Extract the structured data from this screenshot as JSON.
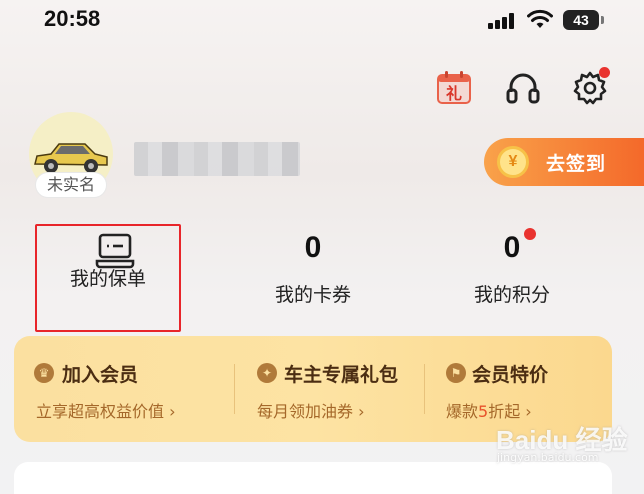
{
  "status_bar": {
    "time": "20:58",
    "battery": "43"
  },
  "header_icons": [
    "gift-calendar-icon",
    "headset-icon",
    "gear-icon"
  ],
  "profile": {
    "verify_status": "未实名",
    "checkin_label": "去签到",
    "coin_symbol": "¥"
  },
  "stats": {
    "policy_label": "我的保单",
    "coupons_value": "0",
    "coupons_label": "我的卡券",
    "points_value": "0",
    "points_label": "我的积分"
  },
  "membership": {
    "items": [
      {
        "title": "加入会员",
        "subtitle": "立享超高权益价值 ›",
        "icon": "crown-icon"
      },
      {
        "title": "车主专属礼包",
        "subtitle": "每月领加油券 ›",
        "icon": "gift-bag-icon"
      },
      {
        "title": "会员特价",
        "subtitle_prefix": "爆款",
        "subtitle_highlight": "5",
        "subtitle_suffix": "折起 ›",
        "icon": "flag-icon"
      }
    ]
  },
  "watermark": {
    "text": "Baidu 经验",
    "sub": "jingyan.baidu.com"
  },
  "colors": {
    "accent_orange": "#f4692a",
    "notify_red": "#e9332f",
    "highlight_red": "#e8252a",
    "vip_gold": "#fbe0a0"
  }
}
